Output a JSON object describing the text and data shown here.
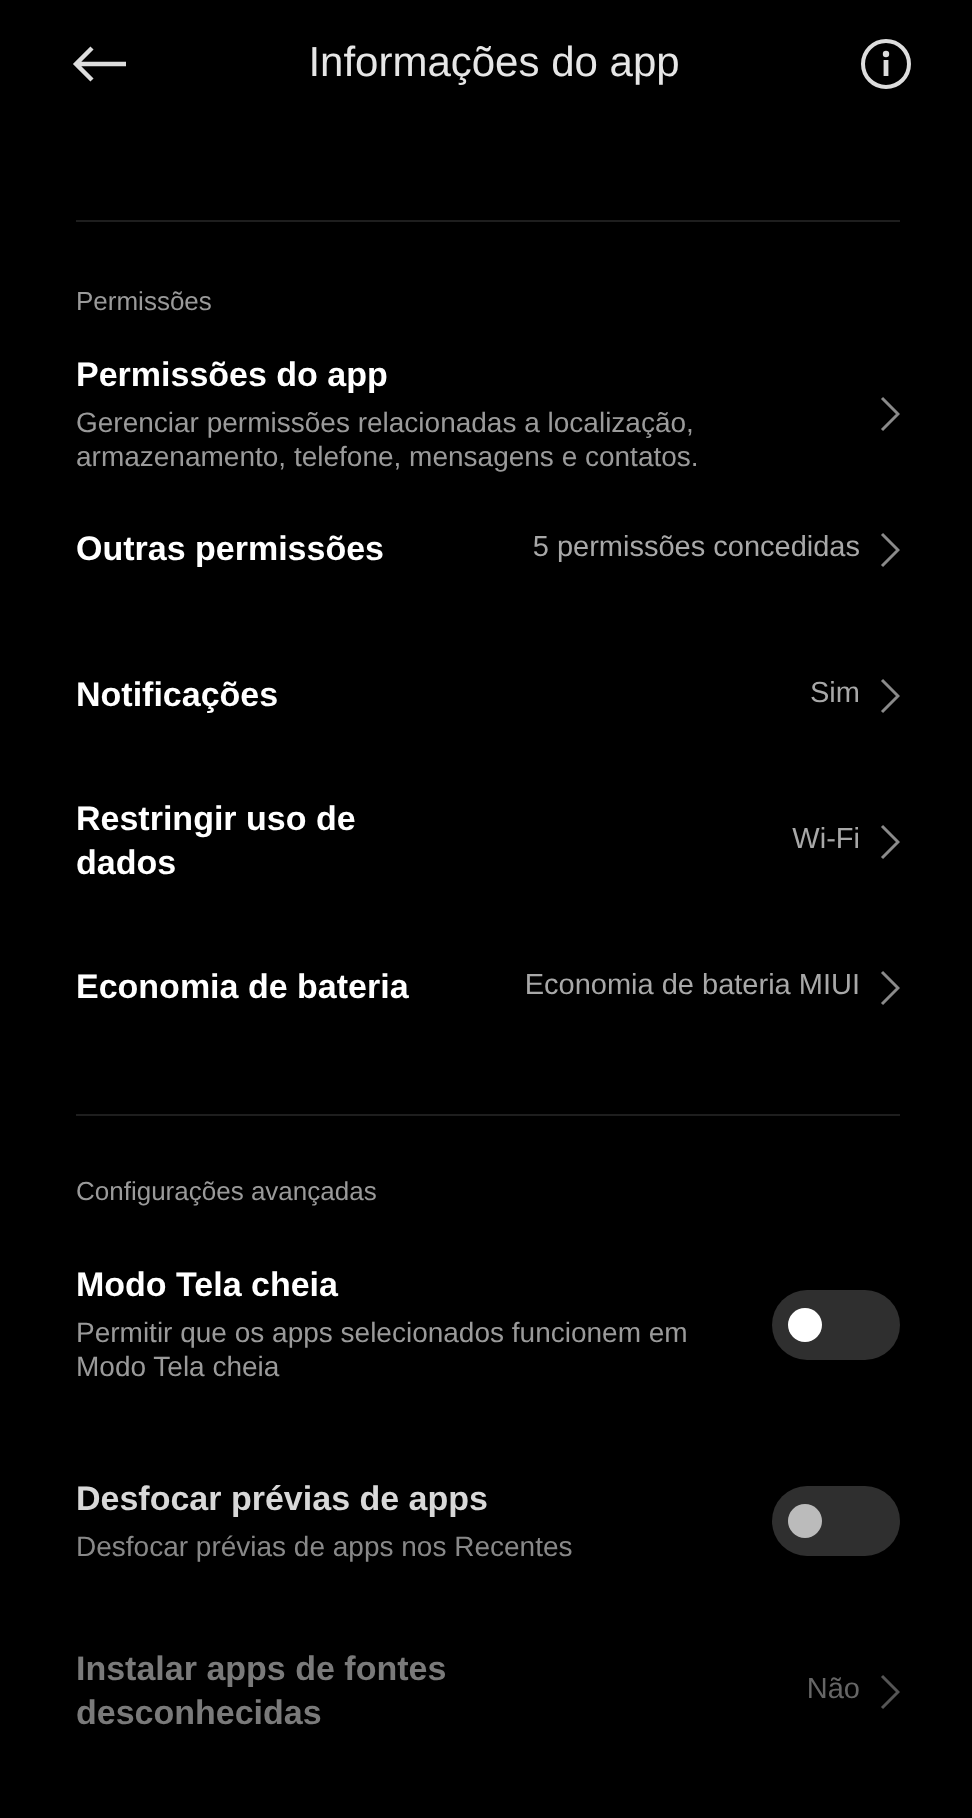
{
  "header": {
    "title": "Informações do app"
  },
  "sections": [
    {
      "label": "Permissões",
      "items": [
        {
          "kind": "link",
          "title": "Permissões do app",
          "subtitle": "Gerenciar permissões relacionadas a localização, armazenamento, telefone, mensagens e contatos.",
          "disabled": false
        },
        {
          "kind": "link",
          "title": "Outras permissões",
          "value": "5 permissões concedidas",
          "disabled": false
        },
        {
          "kind": "link",
          "title": "Notificações",
          "value": "Sim",
          "disabled": false
        },
        {
          "kind": "link",
          "title": "Restringir uso de\ndados",
          "value": "Wi-Fi",
          "disabled": false
        },
        {
          "kind": "link",
          "title": "Economia de bateria",
          "value": "Economia de bateria MIUI",
          "disabled": false
        }
      ]
    },
    {
      "label": "Configurações avançadas",
      "items": [
        {
          "kind": "toggle",
          "title": "Modo Tela cheia",
          "subtitle": "Permitir que os apps selecionados funcionem em Modo Tela cheia",
          "on": false,
          "disabled": false
        },
        {
          "kind": "toggle",
          "title": "Desfocar prévias de apps",
          "subtitle": "Desfocar prévias de apps nos Recentes",
          "on": false,
          "disabled": true
        },
        {
          "kind": "link",
          "title": "Instalar apps de fontes\ndesconhecidas",
          "value": "Não",
          "disabled": true
        }
      ]
    }
  ]
}
